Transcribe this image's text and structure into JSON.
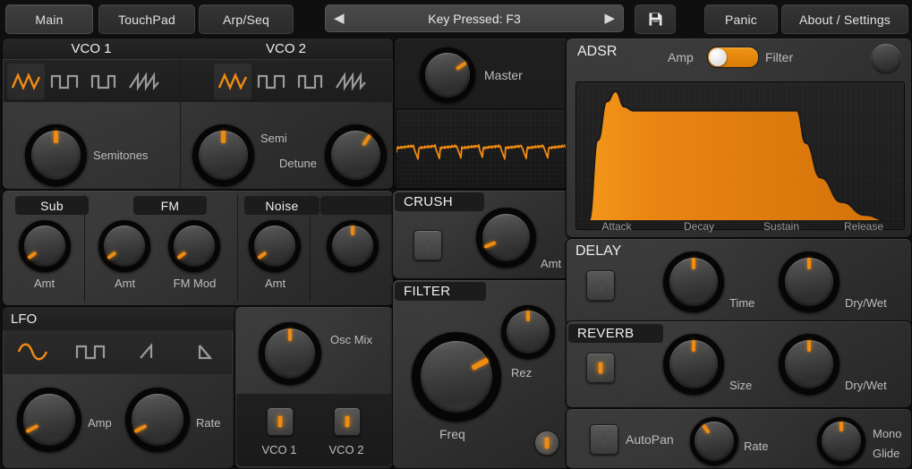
{
  "topbar": {
    "tabs": [
      {
        "label": "Main",
        "active": true
      },
      {
        "label": "TouchPad",
        "active": false
      },
      {
        "label": "Arp/Seq",
        "active": false
      }
    ],
    "key_display": "Key Pressed: F3",
    "prev_arrow": "◀",
    "next_arrow": "▶",
    "save_icon": "floppy-disk-icon",
    "buttons": [
      {
        "label": "Panic"
      },
      {
        "label": "About / Settings"
      }
    ]
  },
  "vco1": {
    "title": "VCO 1",
    "waveforms": [
      {
        "name": "triangle",
        "selected": true
      },
      {
        "name": "square",
        "selected": false
      },
      {
        "name": "pulse",
        "selected": false
      },
      {
        "name": "saw",
        "selected": false
      }
    ],
    "knobs": [
      {
        "label": "Semitones",
        "value": 50
      }
    ]
  },
  "vco2": {
    "title": "VCO 2",
    "waveforms": [
      {
        "name": "triangle",
        "selected": true
      },
      {
        "name": "square",
        "selected": false
      },
      {
        "name": "pulse",
        "selected": false
      },
      {
        "name": "saw",
        "selected": false
      }
    ],
    "knobs": [
      {
        "label": "Semi",
        "value": 50
      },
      {
        "label": "Detune",
        "value": 62
      }
    ]
  },
  "sub": {
    "title": "Sub",
    "knobs": [
      {
        "label": "Amt",
        "value": 5
      }
    ]
  },
  "fm": {
    "title": "FM",
    "knobs": [
      {
        "label": "Amt",
        "value": 5
      },
      {
        "label": "FM Mod",
        "value": 5
      }
    ]
  },
  "noise": {
    "title": "Noise",
    "knobs": [
      {
        "label": "Amt",
        "value": 5
      }
    ]
  },
  "extra": {
    "title": "",
    "knobs": [
      {
        "label": "",
        "value": 50
      }
    ]
  },
  "lfo": {
    "title": "LFO",
    "waveforms": [
      {
        "name": "sine",
        "selected": true
      },
      {
        "name": "square",
        "selected": false
      },
      {
        "name": "ramp-up",
        "selected": false
      },
      {
        "name": "ramp-down",
        "selected": false
      }
    ],
    "knobs": [
      {
        "label": "Amp",
        "value": 8
      },
      {
        "label": "Rate",
        "value": 8
      }
    ]
  },
  "oscmix": {
    "knobs": [
      {
        "label": "Osc Mix",
        "value": 50
      }
    ],
    "toggles": [
      {
        "label": "VCO 1",
        "on": true
      },
      {
        "label": "VCO 2",
        "on": true
      }
    ]
  },
  "master": {
    "knobs": [
      {
        "label": "Master",
        "value": 70
      }
    ],
    "scope": {
      "name": "oscilloscope",
      "wave_color": "#f08a12"
    }
  },
  "crush": {
    "title": "CRUSH",
    "enabled": false,
    "knobs": [
      {
        "label": "Amt",
        "value": 10
      }
    ]
  },
  "filter": {
    "title": "FILTER",
    "enabled": true,
    "knobs": [
      {
        "label": "Freq",
        "value": 72
      },
      {
        "label": "Rez",
        "value": 50
      }
    ]
  },
  "adsr": {
    "title": "ADSR",
    "mode_left": "Amp",
    "mode_right": "Filter",
    "mode_selected": "Amp",
    "stage_labels": [
      "Attack",
      "Decay",
      "Sustain",
      "Release"
    ]
  },
  "delay": {
    "title": "DELAY",
    "enabled": false,
    "knobs": [
      {
        "label": "Time",
        "value": 50
      },
      {
        "label": "Dry/Wet",
        "value": 50
      }
    ]
  },
  "reverb": {
    "title": "REVERB",
    "enabled": true,
    "knobs": [
      {
        "label": "Size",
        "value": 50
      },
      {
        "label": "Dry/Wet",
        "value": 50
      }
    ]
  },
  "bottom": {
    "autopan": {
      "label": "AutoPan",
      "enabled": false
    },
    "knobs": [
      {
        "label": "Rate",
        "value": 38
      },
      {
        "label": "Mono Glide",
        "value": 50
      }
    ],
    "mono_glide_line1": "Mono",
    "mono_glide_line2": "Glide"
  },
  "chart_data": {
    "type": "area",
    "title": "ADSR Envelope",
    "xlabel": "",
    "ylabel": "",
    "categories": [
      "Attack",
      "Decay",
      "Sustain",
      "Release"
    ],
    "points": [
      {
        "x": 0,
        "y": 0
      },
      {
        "x": 3,
        "y": 62
      },
      {
        "x": 6,
        "y": 92
      },
      {
        "x": 9,
        "y": 100
      },
      {
        "x": 12,
        "y": 88
      },
      {
        "x": 15,
        "y": 85
      },
      {
        "x": 70,
        "y": 85
      },
      {
        "x": 73,
        "y": 60
      },
      {
        "x": 78,
        "y": 33
      },
      {
        "x": 85,
        "y": 14
      },
      {
        "x": 93,
        "y": 4
      },
      {
        "x": 100,
        "y": 0
      }
    ],
    "ylim": [
      0,
      100
    ],
    "xlim": [
      0,
      100
    ],
    "fill_color": "#e07c10",
    "grid": true,
    "legend": false
  },
  "colors": {
    "accent": "#ef8b11",
    "panel": "#333333",
    "background": "#111111",
    "text": "#c9c9c9"
  }
}
